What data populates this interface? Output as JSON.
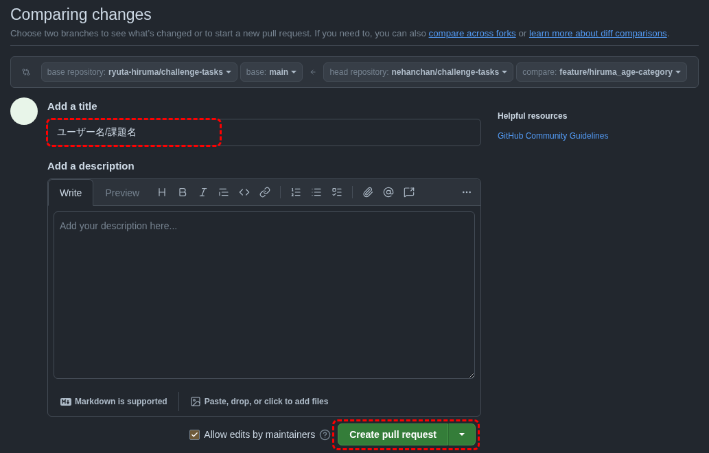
{
  "header": {
    "title": "Comparing changes",
    "subtitle": [
      {
        "kind": "text",
        "text": "Choose two branches to see what’s changed or to start a new pull request. If you need to, you can also"
      },
      {
        "kind": "link",
        "text": "compare across forks"
      },
      {
        "kind": "text",
        "text": "or"
      },
      {
        "kind": "link",
        "text": "learn more about diff comparisons"
      },
      {
        "kind": "text",
        "text": "."
      }
    ]
  },
  "compare": {
    "base": [
      {
        "label": "base repository:",
        "value": "ryuta-hiruma/challenge-tasks"
      },
      {
        "label": "base:",
        "value": "main"
      }
    ],
    "head": [
      {
        "label": "head repository:",
        "value": "nehanchan/challenge-tasks"
      },
      {
        "label": "compare:",
        "value": "feature/hiruma_age-category"
      }
    ]
  },
  "form": {
    "title_label": "Add a title",
    "title_value": "ユーザー名/課題名",
    "title_highlighted": true,
    "description_label": "Add a description",
    "tabs": [
      {
        "label": "Write",
        "selected": true
      },
      {
        "label": "Preview",
        "selected": false
      }
    ],
    "placeholder": "Add your description here...",
    "footer": [
      "Markdown is supported",
      "Paste, drop, or click to add files"
    ],
    "allow_edits": {
      "label": "Allow edits by maintainers",
      "checked": true
    },
    "submit": {
      "label": "Create pull request",
      "highlighted": true
    }
  },
  "sidebar": {
    "title": "Helpful resources",
    "links": [
      "GitHub Community Guidelines"
    ]
  }
}
